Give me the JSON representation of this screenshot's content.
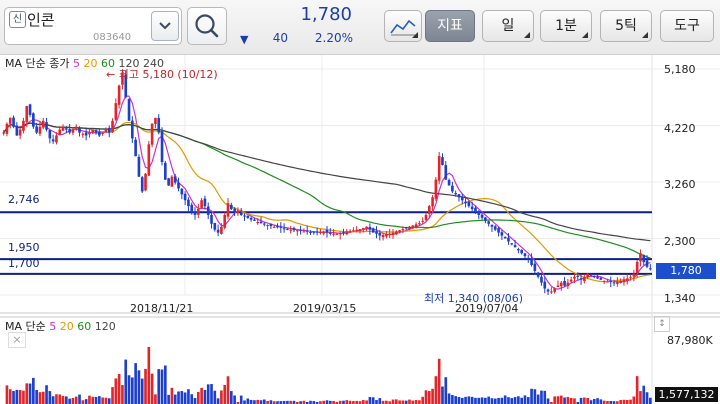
{
  "header": {
    "badge": "신",
    "stock_name": "인콘",
    "stock_code": "083640",
    "price": "1,780",
    "change_arrow": "▼",
    "change": "40",
    "change_rate": "2.20%",
    "buttons": {
      "chart_type_icon": "line-chart-icon",
      "indicator": "지표",
      "period": "일",
      "minute": "1분",
      "tick": "5틱",
      "tools": "도구"
    }
  },
  "price_chart": {
    "ma_label": "MA 단순 종가",
    "ma_periods": [
      {
        "period": "5",
        "color": "#cc33cc"
      },
      {
        "period": "20",
        "color": "#e09a00"
      },
      {
        "period": "60",
        "color": "#1f8c1f"
      },
      {
        "period": "120",
        "color": "#444444"
      },
      {
        "period": "240",
        "color": "#444444"
      }
    ],
    "high_note": "← 최고 5,180 (10/12)",
    "low_note": "최저 1,340 (08/06)",
    "y_ticks": [
      "5,180",
      "4,220",
      "3,260",
      "2,300",
      "1,340"
    ],
    "current_price_tag": "1,780",
    "level_lines": [
      "2,746",
      "1,950",
      "1,700"
    ],
    "x_dates": [
      "2018/11/21",
      "2019/03/15",
      "2019/07/04"
    ]
  },
  "volume_chart": {
    "ma_label": "MA 단순",
    "ma_periods": [
      {
        "period": "5",
        "color": "#cc33cc"
      },
      {
        "period": "20",
        "color": "#e09a00"
      },
      {
        "period": "60",
        "color": "#1f8c1f"
      },
      {
        "period": "120",
        "color": "#444444"
      }
    ],
    "max_volume": "87,980K",
    "current_volume": "1,577,132"
  },
  "colors": {
    "up": "#e0262b",
    "down": "#1d3fcc",
    "level_line": "#0b1f8a",
    "price_text": "#1b3fa8"
  },
  "chart_data": {
    "type": "candlestick",
    "y_range": [
      1340,
      5180
    ],
    "closes": [
      4100,
      4250,
      4350,
      4200,
      4050,
      4150,
      4300,
      4550,
      4400,
      4200,
      4100,
      4200,
      4300,
      4150,
      4000,
      3950,
      4050,
      4150,
      4200,
      4150,
      4100,
      4150,
      4200,
      4100,
      4080,
      4050,
      4100,
      4150,
      4100,
      4050,
      4100,
      4150,
      4100,
      4300,
      4600,
      4900,
      5100,
      4700,
      4300,
      4000,
      3700,
      3350,
      3100,
      3400,
      3900,
      4250,
      4350,
      4100,
      3600,
      3300,
      3200,
      3350,
      3250,
      3150,
      3050,
      2950,
      2850,
      2750,
      2700,
      2800,
      2950,
      2850,
      2700,
      2550,
      2450,
      2400,
      2500,
      2700,
      2900,
      2800,
      2750,
      2750,
      2700,
      2680,
      2650,
      2620,
      2600,
      2580,
      2560,
      2540,
      2530,
      2510,
      2500,
      2490,
      2480,
      2470,
      2460,
      2450,
      2440,
      2440,
      2430,
      2420,
      2420,
      2410,
      2400,
      2400,
      2410,
      2420,
      2400,
      2390,
      2380,
      2380,
      2390,
      2400,
      2420,
      2430,
      2440,
      2450,
      2460,
      2480,
      2500,
      2450,
      2400,
      2380,
      2350,
      2360,
      2370,
      2380,
      2400,
      2420,
      2440,
      2460,
      2480,
      2500,
      2520,
      2540,
      2560,
      2600,
      2700,
      2850,
      3000,
      3300,
      3700,
      3550,
      3300,
      3200,
      3100,
      3050,
      3000,
      2950,
      2900,
      2850,
      2800,
      2750,
      2700,
      2650,
      2600,
      2550,
      2500,
      2450,
      2400,
      2350,
      2300,
      2250,
      2200,
      2150,
      2100,
      2050,
      2000,
      1950,
      1850,
      1750,
      1650,
      1550,
      1450,
      1400,
      1400,
      1450,
      1500,
      1550,
      1500,
      1550,
      1600,
      1650,
      1650,
      1600,
      1650,
      1700,
      1680,
      1650,
      1620,
      1600,
      1580,
      1570,
      1560,
      1550,
      1560,
      1580,
      1600,
      1620,
      1650,
      1700,
      1900,
      2050,
      1900,
      1820,
      1780
    ]
  }
}
